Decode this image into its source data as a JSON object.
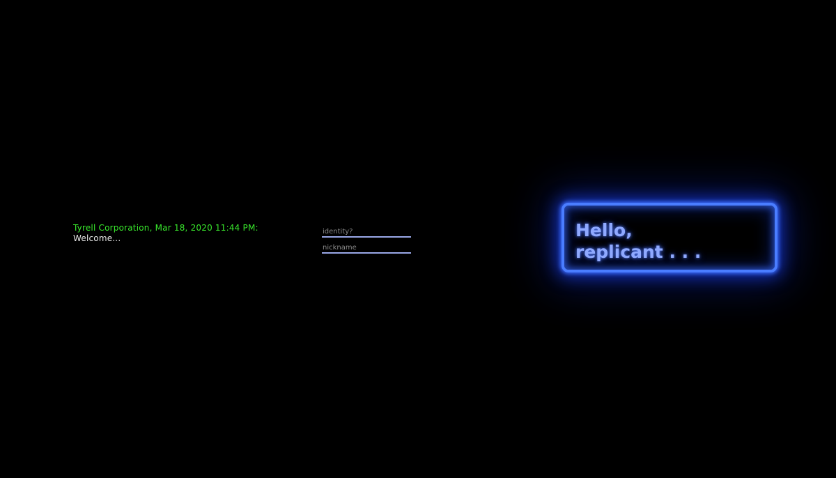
{
  "terminal": {
    "header": "Tyrell Corporation, Mar 18, 2020 11:44 PM:",
    "welcome": "Welcome..."
  },
  "login_form": {
    "identity_placeholder": "identity?",
    "nickname_placeholder": "nickname"
  },
  "neon_sign": {
    "line1": "Hello,",
    "line2": "replicant . . ."
  },
  "colors": {
    "background": "#000000",
    "terminal_header": "#39e82c",
    "terminal_text": "#e9e9e9",
    "neon_border": "#4a7dff",
    "neon_text": "#8fa9ff",
    "input_underline": "#9aa8e8"
  }
}
